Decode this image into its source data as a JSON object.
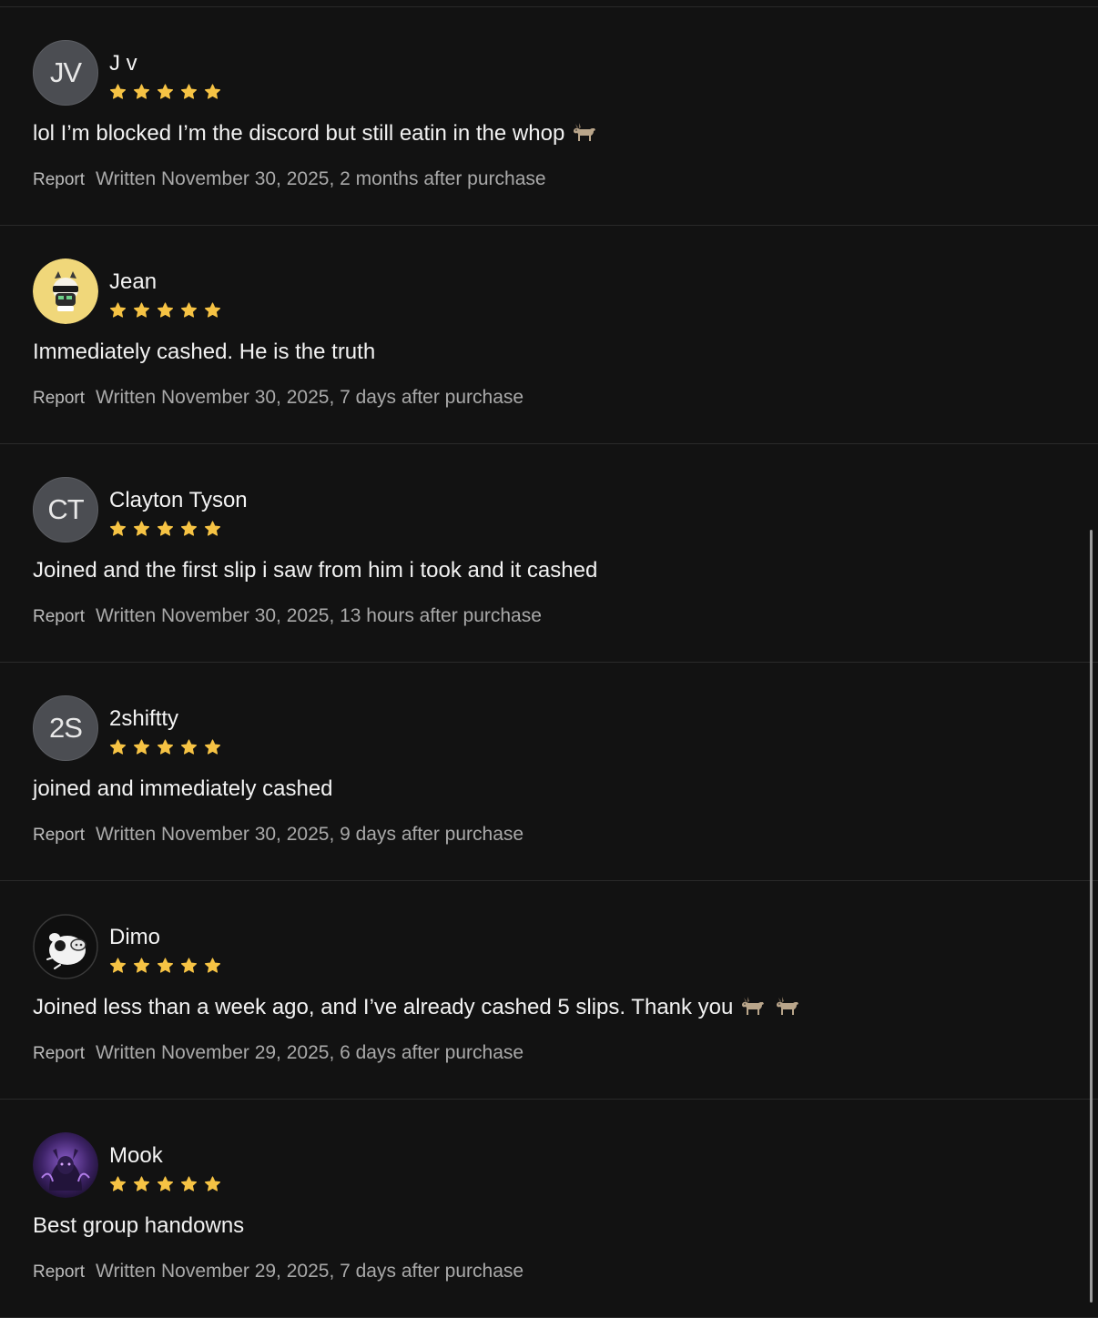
{
  "colors": {
    "background": "#121212",
    "star": "#f6c344",
    "divider": "#2a2a2a",
    "meta_text": "#a9a9a9"
  },
  "reviews": [
    {
      "reviewer": "J v",
      "avatar_type": "initials",
      "initials": "JV",
      "rating": 5,
      "text": "lol I’m blocked I’m the discord but still eatin in the whop",
      "emoji": [
        "goat-emoji"
      ],
      "report_label": "Report",
      "written": "Written November 30, 2025, 2 months after purchase"
    },
    {
      "reviewer": "Jean",
      "avatar_type": "image",
      "avatar_icon": "cartoon-character-avatar",
      "rating": 5,
      "text": "Immediately cashed. He is the truth",
      "emoji": [],
      "report_label": "Report",
      "written": "Written November 30, 2025, 7 days after purchase"
    },
    {
      "reviewer": "Clayton Tyson",
      "avatar_type": "initials",
      "initials": "CT",
      "rating": 5,
      "text": "Joined and the first slip i saw from him i took and it cashed",
      "emoji": [],
      "report_label": "Report",
      "written": "Written November 30, 2025, 13 hours after purchase"
    },
    {
      "reviewer": "2shiftty",
      "avatar_type": "initials",
      "initials": "2S",
      "rating": 5,
      "text": "joined and immediately cashed",
      "emoji": [],
      "report_label": "Report",
      "written": "Written November 30, 2025, 9 days after purchase"
    },
    {
      "reviewer": "Dimo",
      "avatar_type": "image",
      "avatar_icon": "pig-cartoon-avatar",
      "rating": 5,
      "text": "Joined less than a week ago, and I’ve already cashed 5 slips. Thank you",
      "emoji": [
        "goat-emoji",
        "goat-emoji"
      ],
      "report_label": "Report",
      "written": "Written November 29, 2025, 6 days after purchase"
    },
    {
      "reviewer": "Mook",
      "avatar_type": "image",
      "avatar_icon": "dark-demon-avatar",
      "rating": 5,
      "text": "Best group handowns",
      "emoji": [],
      "report_label": "Report",
      "written": "Written November 29, 2025, 7 days after purchase"
    }
  ]
}
